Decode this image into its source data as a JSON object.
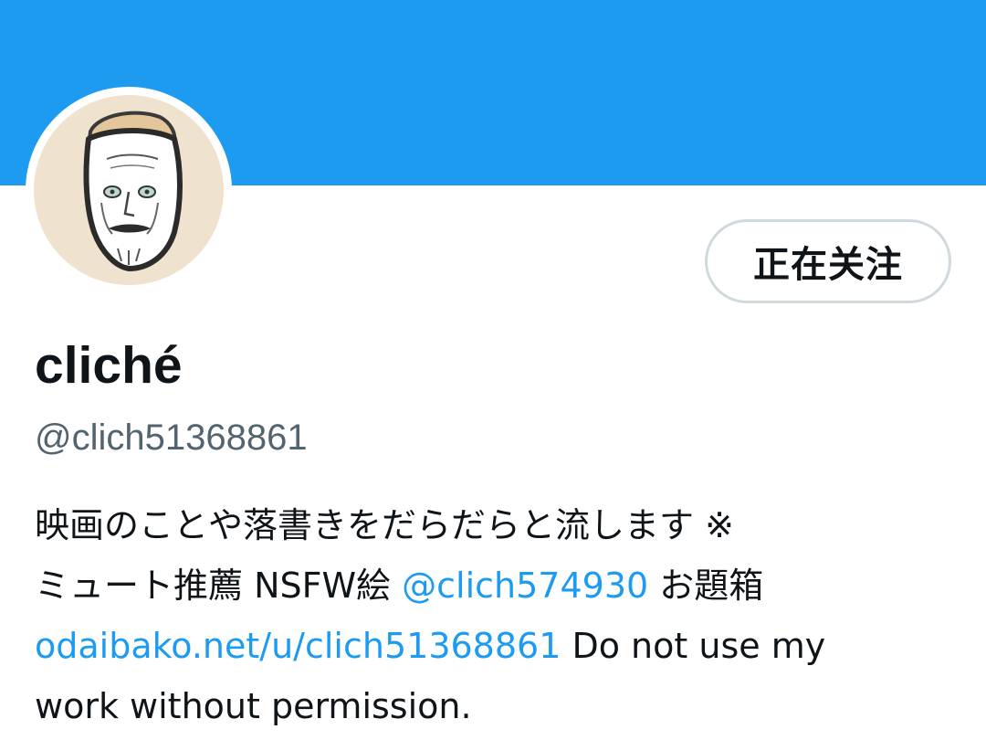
{
  "colors": {
    "banner": "#1d9bf0",
    "link": "#1d9bf0",
    "text": "#0f1419",
    "secondary_text": "#536471",
    "button_border": "#cfd9de",
    "avatar_bg": "#efe2cf"
  },
  "profile": {
    "avatar_icon": "avatar-illustration",
    "follow_button_label": "正在关注",
    "display_name": "cliché",
    "handle": "@clich51368861"
  },
  "bio": {
    "line1": "映画のことや落書きをだらだらと流します ※",
    "line2_prefix": "ミュート推薦 NSFW絵 ",
    "line2_mention": "@clich574930",
    "line2_suffix": " お題箱",
    "line3_link": "odaibako.net/u/clich51368861",
    "line3_suffix": " Do not use my",
    "line4": "work without permission."
  }
}
